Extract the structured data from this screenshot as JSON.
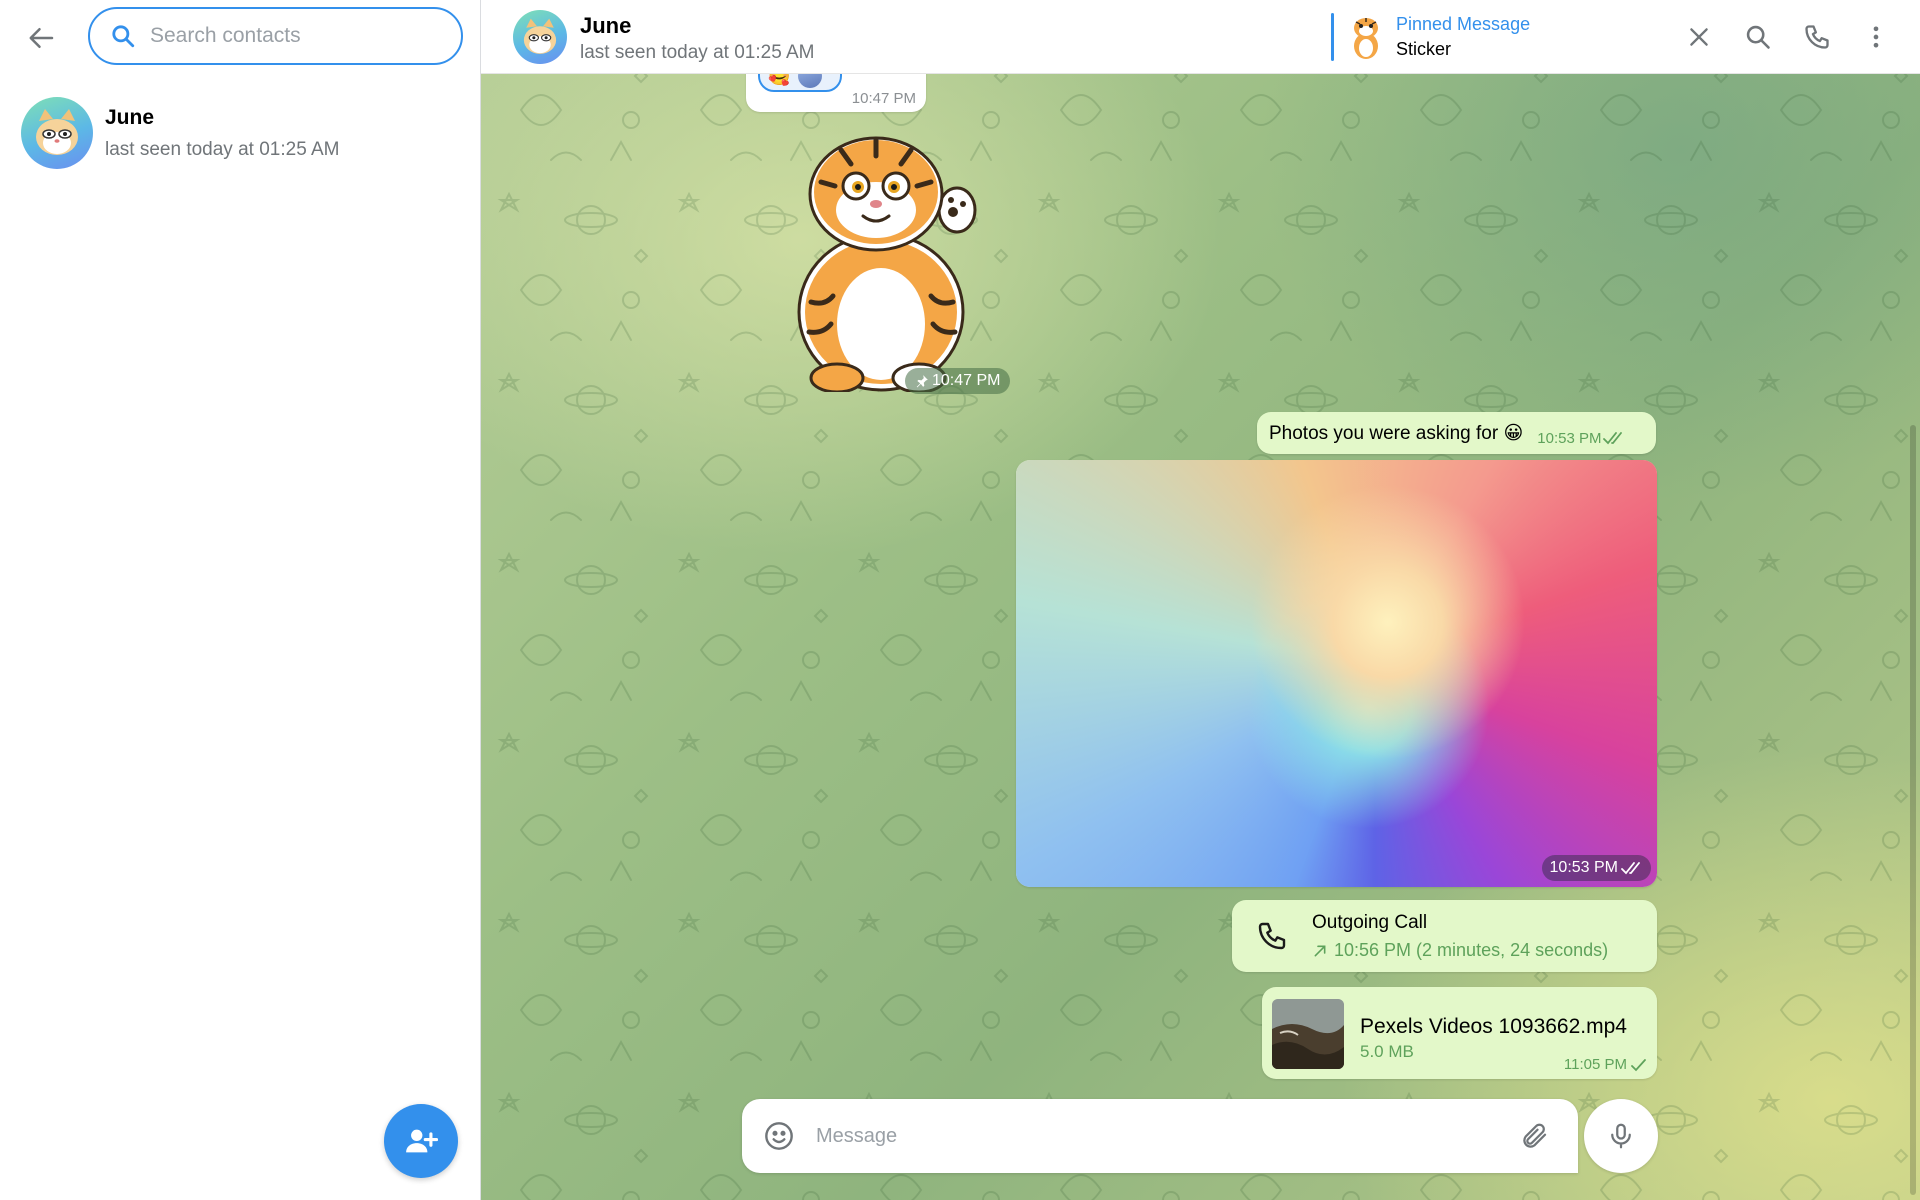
{
  "sidebar": {
    "search_placeholder": "Search contacts",
    "contacts": [
      {
        "name": "June",
        "status": "last seen today at 01:25 AM"
      }
    ]
  },
  "chat": {
    "header": {
      "name": "June",
      "status": "last seen today at 01:25 AM",
      "pinned_title": "Pinned Message",
      "pinned_subtitle": "Sticker"
    },
    "messages": {
      "previous_time": "10:47 PM",
      "sticker_time": "10:47 PM",
      "text_message": "Photos you were asking for 😀",
      "text_time": "10:53 PM",
      "photo_time": "10:53 PM",
      "call_title": "Outgoing Call",
      "call_detail": "10:56 PM (2 minutes, 24 seconds)",
      "file_name": "Pexels Videos 1093662.mp4",
      "file_size": "5.0 MB",
      "file_time": "11:05 PM"
    },
    "composer": {
      "placeholder": "Message"
    }
  },
  "colors": {
    "accent": "#3390ec",
    "outgoing_bubble": "#e3f8c9",
    "outgoing_meta": "#5ea25b"
  },
  "icons": {
    "back": "arrow-left-icon",
    "search": "search-icon",
    "close": "close-icon",
    "call": "phone-icon",
    "more": "more-vertical-icon",
    "add_contact": "add-user-icon",
    "emoji": "smile-icon",
    "attach": "paperclip-icon",
    "mic": "microphone-icon"
  }
}
